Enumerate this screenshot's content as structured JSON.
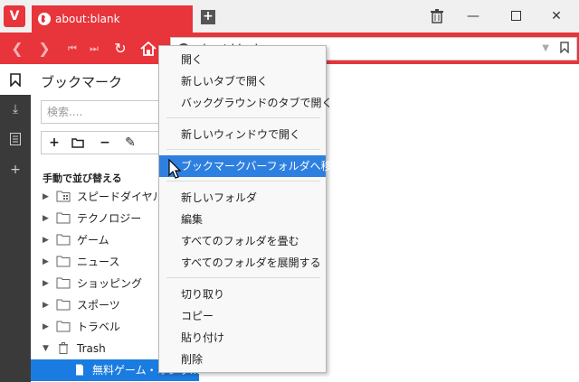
{
  "tab": {
    "title": "about:blank"
  },
  "address": {
    "value": "about:blank"
  },
  "panel": {
    "title": "ブックマーク",
    "search_placeholder": "検索....",
    "sort_label": "手動で並び替える",
    "items": [
      {
        "label": "スピードダイヤル",
        "icon": "speed-dial-folder-icon"
      },
      {
        "label": "テクノロジー",
        "icon": "folder-icon"
      },
      {
        "label": "ゲーム",
        "icon": "folder-icon"
      },
      {
        "label": "ニュース",
        "icon": "folder-icon"
      },
      {
        "label": "ショッピング",
        "icon": "folder-icon"
      },
      {
        "label": "スポーツ",
        "icon": "folder-icon"
      },
      {
        "label": "トラベル",
        "icon": "folder-icon"
      },
      {
        "label": "Trash",
        "icon": "trash-icon"
      },
      {
        "label": "無料ゲーム・オンラ...",
        "icon": "page-icon"
      }
    ]
  },
  "context_menu": {
    "items": [
      "開く",
      "新しいタブで開く",
      "バックグラウンドのタブで開く",
      "新しいウィンドウで開く",
      "ブックマークバーフォルダへ移動",
      "新しいフォルダ",
      "編集",
      "すべてのフォルダを畳む",
      "すべてのフォルダを展開する",
      "切り取り",
      "コピー",
      "貼り付け",
      "削除"
    ],
    "highlighted_index": 4
  },
  "colors": {
    "accent": "#e8343b",
    "highlight": "#2e80e0",
    "selected_row": "#1a7ce0",
    "panel_strip": "#3a3a3a"
  }
}
